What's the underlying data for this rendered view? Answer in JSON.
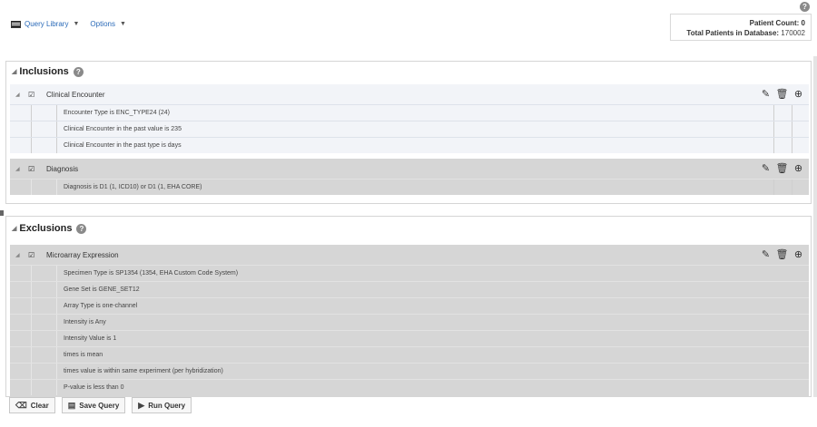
{
  "header": {
    "menu": [
      {
        "label": "Query Library",
        "icon": "library-icon"
      },
      {
        "label": "Options"
      }
    ],
    "help_icon": "?",
    "patient_count_label": "Patient Count:",
    "patient_count_value": "0",
    "total_patients_label": "Total Patients in Database:",
    "total_patients_value": "170002"
  },
  "inclusions": {
    "title": "Inclusions",
    "groups": [
      {
        "name": "Clinical Encounter",
        "conditions": [
          "Encounter Type is ENC_TYPE24 (24)",
          "Clinical Encounter in the past value is 235",
          "Clinical Encounter in the past type is days"
        ]
      },
      {
        "name": "Diagnosis",
        "conditions": [
          "Diagnosis is D1 (1, ICD10) or D1 (1, EHA CORE)"
        ]
      }
    ]
  },
  "exclusions": {
    "title": "Exclusions",
    "groups": [
      {
        "name": "Microarray Expression",
        "conditions": [
          "Specimen Type is SP1354 (1354, EHA Custom Code System)",
          "Gene Set is GENE_SET12",
          "Array Type is one-channel",
          "Intensity is Any",
          "Intensity Value is 1",
          "times is mean",
          "times value is within same experiment (per hybridization)",
          "P-value is less than 0"
        ]
      }
    ]
  },
  "footer": {
    "buttons": [
      {
        "label": "Clear",
        "icon": "eraser-icon"
      },
      {
        "label": "Save Query",
        "icon": "save-icon"
      },
      {
        "label": "Run Query",
        "icon": "run-icon"
      }
    ]
  },
  "colors": {
    "link": "#2a6ab8",
    "selected_group_bg": "#d6d6d6",
    "light_group_bg": "#f2f4f8"
  }
}
